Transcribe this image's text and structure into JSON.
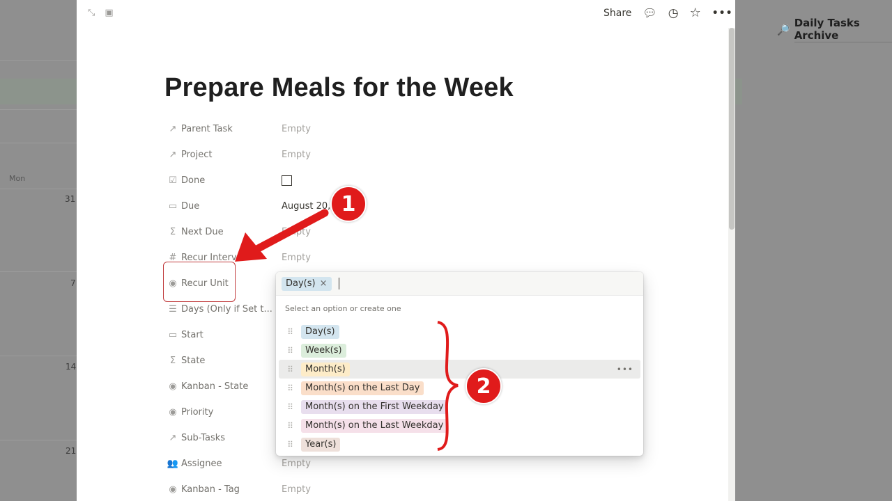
{
  "background": {
    "calendar_day_label": "Mon",
    "calendar_dates": [
      "31",
      "7",
      "14",
      "21"
    ],
    "archive_link": "Daily Tasks Archive",
    "archive_icon": "magnifier-icon"
  },
  "topbar": {
    "share_label": "Share",
    "icons": [
      "expand-icon",
      "peek-mode-icon",
      "comment-icon",
      "history-icon",
      "star-icon",
      "more-icon"
    ]
  },
  "page": {
    "title": "Prepare Meals for the Week",
    "properties": [
      {
        "icon": "↗",
        "label": "Parent Task",
        "value": "Empty"
      },
      {
        "icon": "↗",
        "label": "Project",
        "value": "Empty"
      },
      {
        "icon": "☑",
        "label": "Done",
        "value": ""
      },
      {
        "icon": "▭",
        "label": "Due",
        "value": "August 20, 2"
      },
      {
        "icon": "Σ",
        "label": "Next Due",
        "value": "Empty"
      },
      {
        "icon": "#",
        "label": "Recur Interval",
        "value": "Empty"
      },
      {
        "icon": "◉",
        "label": "Recur Unit",
        "value": ""
      },
      {
        "icon": "☰",
        "label": "Days (Only if Set t...",
        "value": ""
      },
      {
        "icon": "▭",
        "label": "Start",
        "value": ""
      },
      {
        "icon": "Σ",
        "label": "State",
        "value": ""
      },
      {
        "icon": "◉",
        "label": "Kanban - State",
        "value": ""
      },
      {
        "icon": "◉",
        "label": "Priority",
        "value": ""
      },
      {
        "icon": "↗",
        "label": "Sub-Tasks",
        "value": ""
      },
      {
        "icon": "👥",
        "label": "Assignee",
        "value": "Empty"
      },
      {
        "icon": "◉",
        "label": "Kanban - Tag",
        "value": "Empty"
      }
    ]
  },
  "dropdown": {
    "selected": {
      "label": "Day(s)",
      "color": "#d3e5ef",
      "remove": "×"
    },
    "hint": "Select an option or create one",
    "options": [
      {
        "label": "Day(s)",
        "color": "#d3e5ef"
      },
      {
        "label": "Week(s)",
        "color": "#dbeddb"
      },
      {
        "label": "Month(s)",
        "color": "#fdecc8",
        "hovered": true
      },
      {
        "label": "Month(s) on the Last Day",
        "color": "#fadec9"
      },
      {
        "label": "Month(s) on the First Weekday",
        "color": "#e8deee"
      },
      {
        "label": "Month(s) on the Last Weekday",
        "color": "#f5e0e9"
      },
      {
        "label": "Year(s)",
        "color": "#eee0da"
      }
    ],
    "more": "•••"
  },
  "annotations": {
    "step1": "1",
    "step2": "2",
    "color": "#e01b1b"
  }
}
